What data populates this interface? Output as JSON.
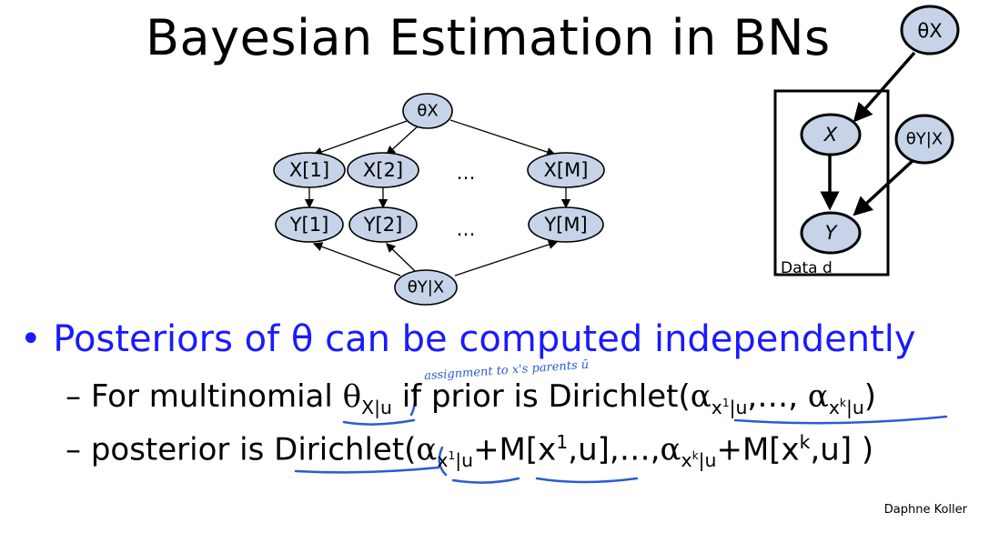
{
  "title": "Bayesian Estimation in BNs",
  "left_diagram": {
    "theta_x": "θX",
    "theta_y_given_x": "θY|X",
    "x_nodes": [
      "X[1]",
      "X[2]",
      "X[M]"
    ],
    "y_nodes": [
      "Y[1]",
      "Y[2]",
      "Y[M]"
    ],
    "ellipsis": "…"
  },
  "plate_diagram": {
    "theta_x": "θX",
    "theta_y_given_x": "θY|X",
    "x_label": "X",
    "y_label": "Y",
    "plate_label": "Data d"
  },
  "bullet1": "• Posteriors of θ can be computed independently",
  "bullet2": {
    "dash": "–",
    "text1": "For multinomial",
    "theta": "θ",
    "theta_sub": "X|u",
    "text2": "if prior is Dirichlet(",
    "alpha1": "α",
    "alpha1_sub_a": "x",
    "alpha1_sup": "1",
    "alpha1_sub_b": "|u",
    "comma": ",…,",
    "alphak": "α",
    "alphak_sub_a": "x",
    "alphak_sup": "k",
    "alphak_sub_b": "|u",
    "close": ")"
  },
  "bullet3": {
    "dash": "–",
    "text1": "posterior is",
    "dirichlet": "Dirichlet(",
    "alpha1": "α",
    "alpha1_sub_a": "x",
    "alpha1_sup": "1",
    "alpha1_sub_b": "|u",
    "plus_m1": "+M[x",
    "sup1": "1",
    "u1": ",u]",
    "mid": ",…,",
    "alphak": "α",
    "alphak_sub_a": "x",
    "alphak_sup": "k",
    "alphak_sub_b": "|u",
    "plus_mk": "+M[x",
    "supk": "k",
    "uk": ",u] )"
  },
  "handwritten_note": "assignment to x's parents ū",
  "credit": "Daphne Koller"
}
